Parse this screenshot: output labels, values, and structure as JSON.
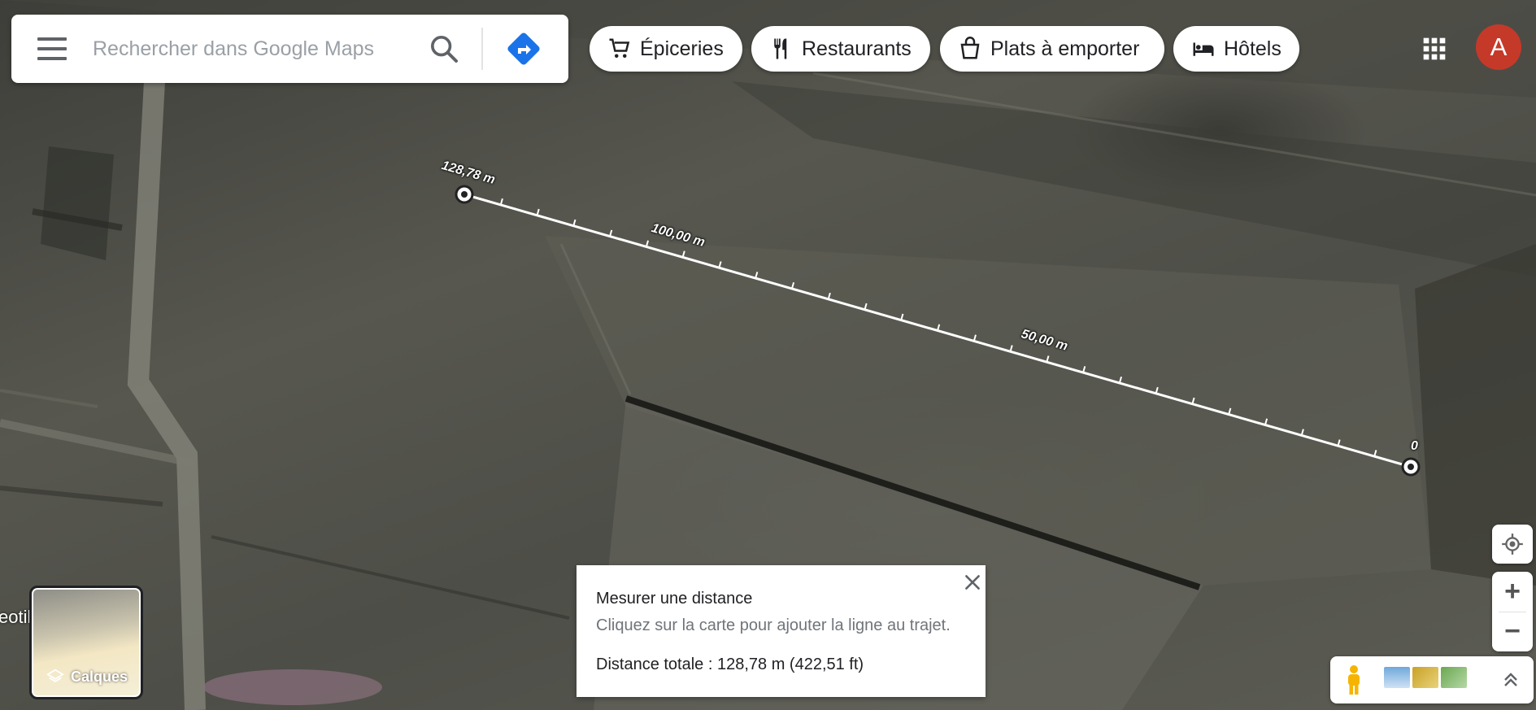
{
  "search": {
    "placeholder": "Rechercher dans Google Maps"
  },
  "header": {
    "icons": {
      "menu": "hamburger-menu-icon",
      "search": "magnifier-icon",
      "directions": "directions-arrow-icon",
      "apps": "apps-grid-icon"
    },
    "chips": [
      {
        "label": "Épiceries",
        "icon": "cart-icon"
      },
      {
        "label": "Restaurants",
        "icon": "fork-knife-icon"
      },
      {
        "label": "Plats à emporter",
        "icon": "takeout-icon"
      },
      {
        "label": "Hôtels",
        "icon": "bed-icon"
      }
    ],
    "avatar_letter": "A"
  },
  "measure": {
    "labels": {
      "end": "128,78 m",
      "mid_100": "100,00 m",
      "mid_50": "50,00 m",
      "start": "0"
    }
  },
  "info_card": {
    "title": "Mesurer une distance",
    "subtitle": "Cliquez sur la carte pour ajouter la ligne au trajet.",
    "total": "Distance totale : 128,78 m (422,51 ft)"
  },
  "layers": {
    "label": "Calques"
  },
  "map": {
    "edge_label": "eotil"
  },
  "controls": {
    "zoom_in": "+",
    "zoom_out": "−"
  },
  "colors": {
    "directions": "#1a73e8",
    "avatar": "#c53929",
    "ruler": "#ffffff"
  }
}
